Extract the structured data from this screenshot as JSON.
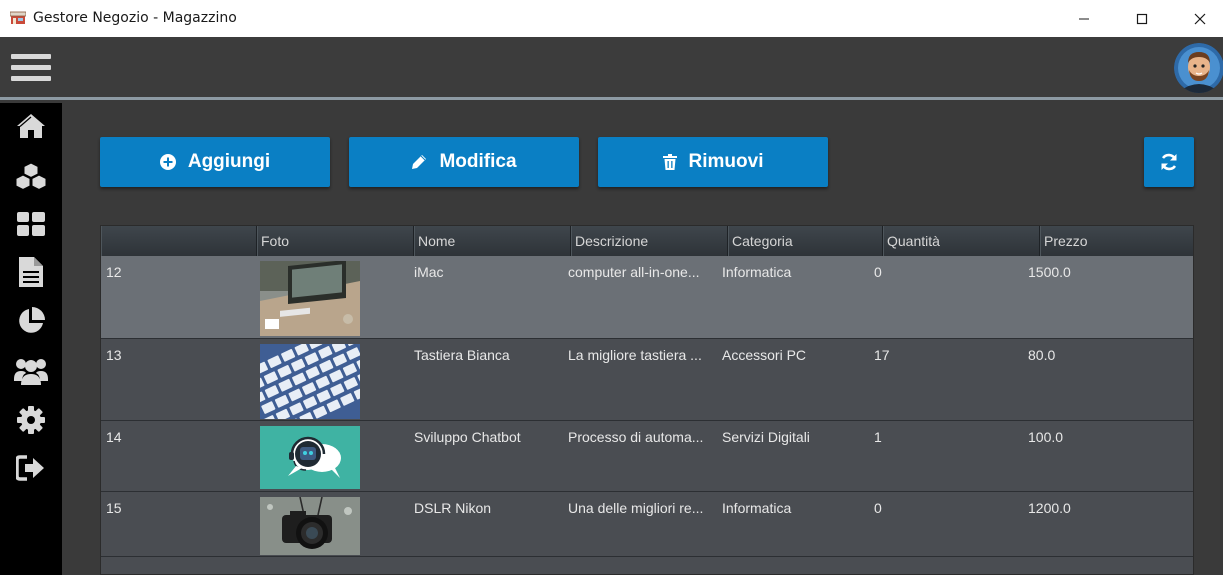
{
  "window": {
    "title": "Gestore Negozio - Magazzino",
    "controls": [
      "minimize",
      "maximize",
      "close"
    ]
  },
  "appbar": {
    "menu_icon": "hamburger-menu-icon",
    "avatar": "user-avatar"
  },
  "sidebar": {
    "items": [
      {
        "icon": "home-icon"
      },
      {
        "icon": "cubes-icon"
      },
      {
        "icon": "grid-icon"
      },
      {
        "icon": "document-icon"
      },
      {
        "icon": "pie-chart-icon"
      },
      {
        "icon": "users-icon"
      },
      {
        "icon": "gear-icon"
      },
      {
        "icon": "logout-icon"
      }
    ]
  },
  "toolbar": {
    "add_label": "Aggiungi",
    "edit_label": "Modifica",
    "remove_label": "Rimuovi",
    "refresh_icon": "refresh-icon"
  },
  "table": {
    "columns": [
      "",
      "Foto",
      "Nome",
      "Descrizione",
      "Categoria",
      "Quantità",
      "Prezzo"
    ],
    "rows": [
      {
        "id": "12",
        "photo": "imac-photo",
        "name": "iMac",
        "description": "computer all-in-one...",
        "category": "Informatica",
        "quantity": "0",
        "price": "1500.0"
      },
      {
        "id": "13",
        "photo": "keyboard-photo",
        "name": "Tastiera Bianca",
        "description": "La migliore tastiera ...",
        "category": "Accessori PC",
        "quantity": "17",
        "price": "80.0"
      },
      {
        "id": "14",
        "photo": "chatbot-photo",
        "name": "Sviluppo Chatbot",
        "description": "Processo di automa...",
        "category": "Servizi Digitali",
        "quantity": "1",
        "price": "100.0"
      },
      {
        "id": "15",
        "photo": "camera-photo",
        "name": "DSLR Nikon",
        "description": "Una delle migliori re...",
        "category": "Informatica",
        "quantity": "0",
        "price": "1200.0"
      }
    ]
  },
  "colors": {
    "accent": "#0a7fc4",
    "sidebar_bg": "#000000",
    "appbar_bg": "#3c3c3c",
    "selected_row": "#6b7076",
    "row_bg": "#4a4d52"
  }
}
